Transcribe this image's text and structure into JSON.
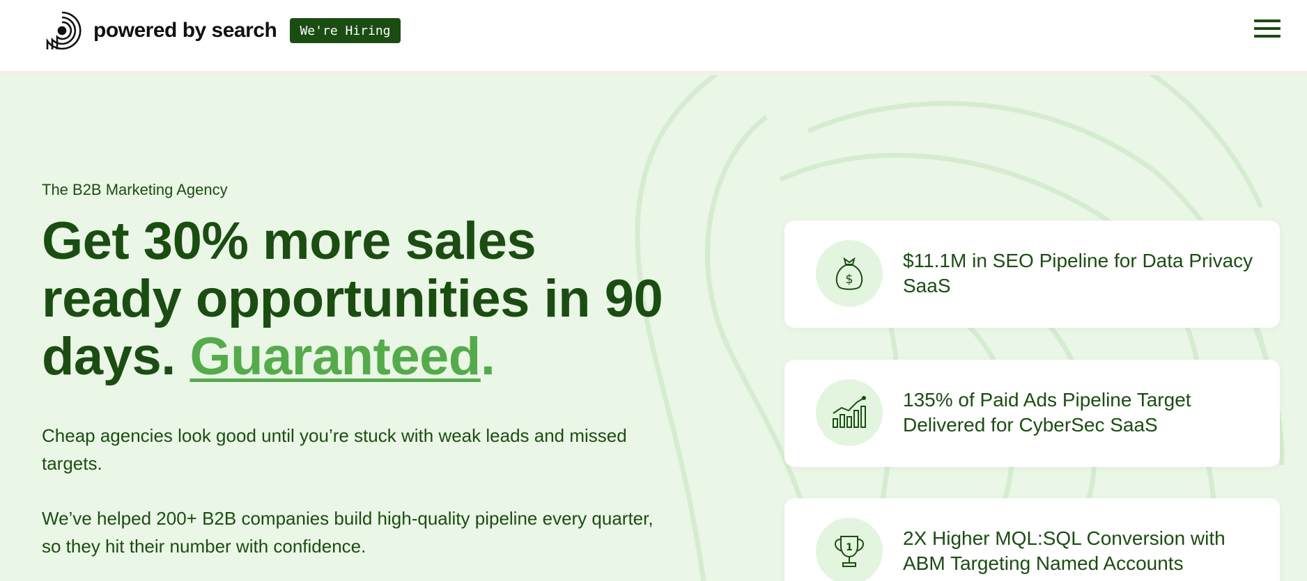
{
  "header": {
    "logo_text": "powered by search",
    "hiring_label": "We're Hiring"
  },
  "hero": {
    "eyebrow": "The B2B Marketing Agency",
    "headline_main": "Get 30% more sales ready opportunities in 90 days.",
    "headline_accent": "Guaranteed",
    "headline_period": ".",
    "paragraph_1": "Cheap agencies look good until you’re stuck with weak leads and missed targets.",
    "paragraph_2": "We’ve helped 200+ B2B companies build high-quality pipeline every quarter, so they hit their number with confidence."
  },
  "stats": [
    {
      "icon": "money-bag-icon",
      "text": "$11.1M in SEO Pipeline for Data Privacy SaaS"
    },
    {
      "icon": "growth-chart-icon",
      "text": "135% of Paid Ads Pipeline Target Delivered for CyberSec SaaS"
    },
    {
      "icon": "trophy-icon",
      "text": "2X Higher MQL:SQL Conversion with ABM Targeting Named Accounts"
    }
  ],
  "colors": {
    "primary": "#1b4d12",
    "accent": "#55ab4c",
    "background": "#eaf6e6"
  }
}
